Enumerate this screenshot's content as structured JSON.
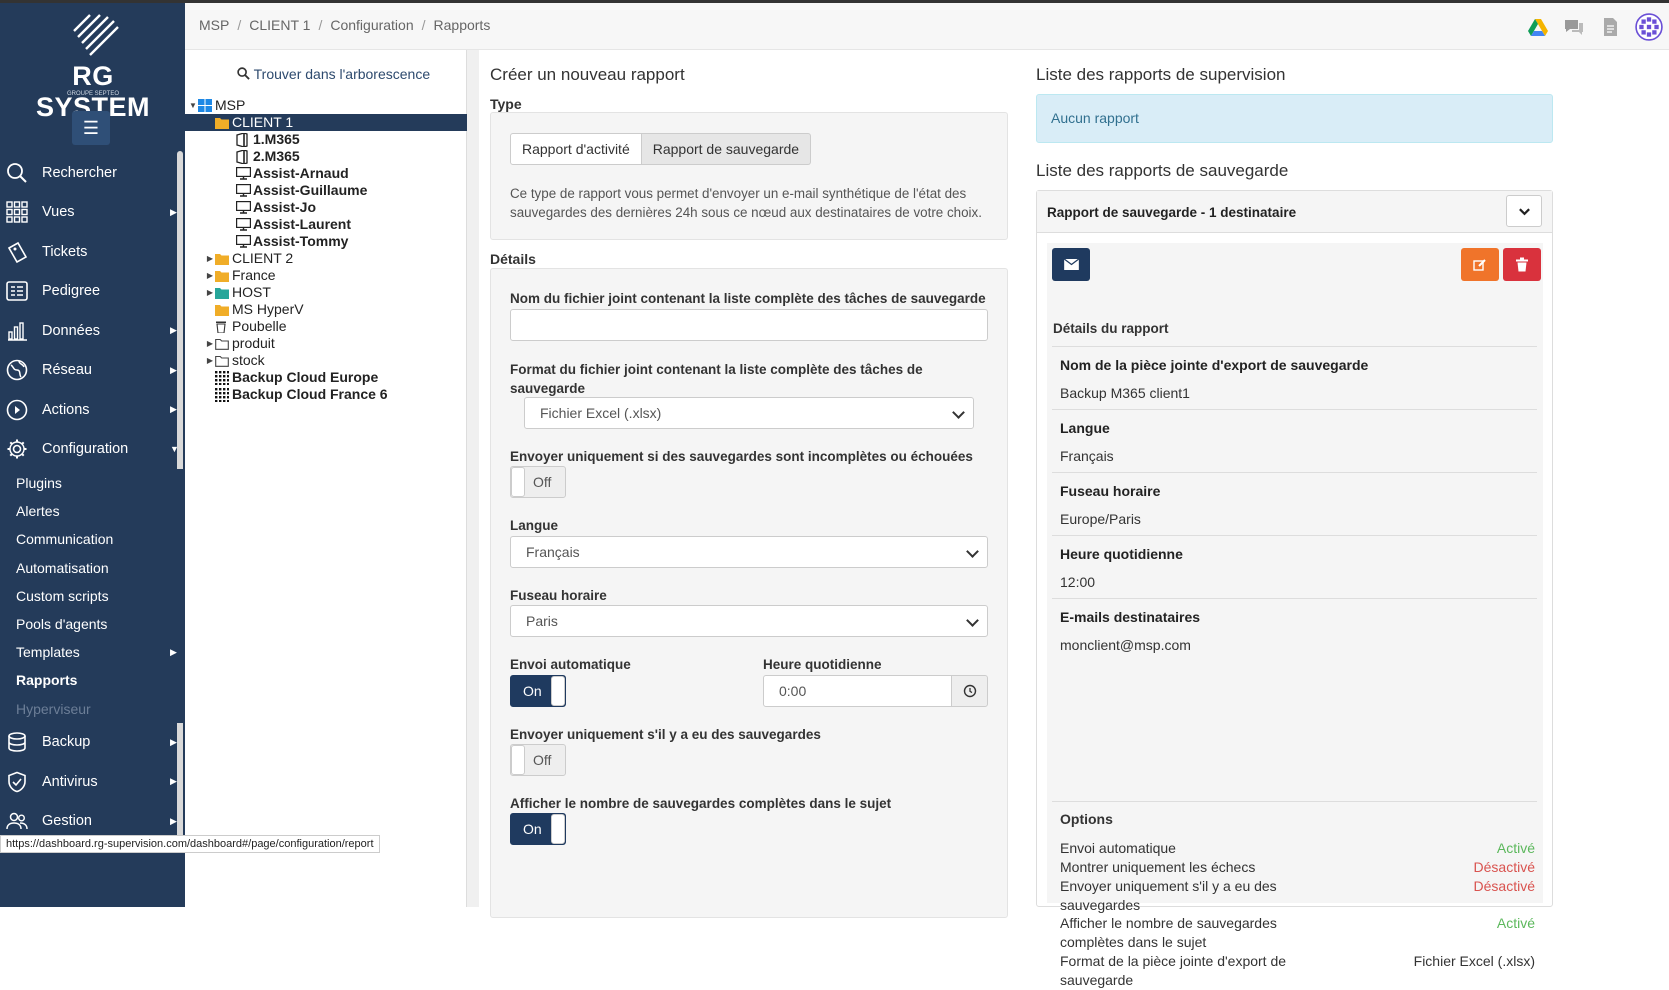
{
  "app": {
    "brand": "RG SYSTEM",
    "brand_sub": "GROUPE SEPTEO",
    "status_url": "https://dashboard.rg-supervision.com/dashboard#/page/configuration/report"
  },
  "colors": {
    "sidebar": "#243b5a",
    "accent": "#1f3a5f",
    "orange": "#f0742a",
    "red": "#d9323d",
    "active_green": "#5cb85c",
    "inactive_red": "#d9534f"
  },
  "breadcrumb": [
    "MSP",
    "CLIENT 1",
    "Configuration",
    "Rapports"
  ],
  "header_icons": [
    "drive-icon",
    "chat-icon",
    "document-icon",
    "avatar-icon"
  ],
  "sidebar": {
    "items": [
      {
        "label": "Rechercher",
        "icon": "search-icon",
        "arrow": false
      },
      {
        "label": "Vues",
        "icon": "grid-icon",
        "arrow": true
      },
      {
        "label": "Tickets",
        "icon": "ticket-icon",
        "arrow": false
      },
      {
        "label": "Pedigree",
        "icon": "list-icon",
        "arrow": false
      },
      {
        "label": "Données",
        "icon": "bar-chart-icon",
        "arrow": true
      },
      {
        "label": "Réseau",
        "icon": "globe-icon",
        "arrow": true
      },
      {
        "label": "Actions",
        "icon": "play-icon",
        "arrow": true
      },
      {
        "label": "Configuration",
        "icon": "gear-icon",
        "arrow": "down"
      }
    ],
    "sub_items": [
      "Plugins",
      "Alertes",
      "Communication",
      "Automatisation",
      "Custom scripts",
      "Pools d'agents",
      "Templates",
      "Rapports",
      "Hyperviseur"
    ],
    "bottom_items": [
      {
        "label": "Backup",
        "icon": "database-icon"
      },
      {
        "label": "Antivirus",
        "icon": "shield-icon"
      },
      {
        "label": "Gestion",
        "icon": "users-icon"
      }
    ]
  },
  "tree": {
    "find_label": "Trouver dans l'arborescence",
    "nodes": [
      {
        "label": "MSP",
        "level": 0,
        "toggle": "▼",
        "icon": "windows-icon",
        "bold": false,
        "selected": false
      },
      {
        "label": "CLIENT 1",
        "level": 1,
        "toggle": "",
        "icon": "folder-icon",
        "bold": false,
        "selected": true
      },
      {
        "label": "1.M365",
        "level": 2,
        "toggle": "",
        "icon": "office-icon",
        "bold": true,
        "selected": false
      },
      {
        "label": "2.M365",
        "level": 2,
        "toggle": "",
        "icon": "office-icon",
        "bold": true,
        "selected": false
      },
      {
        "label": "Assist-Arnaud",
        "level": 2,
        "toggle": "",
        "icon": "monitor-icon",
        "bold": true,
        "selected": false
      },
      {
        "label": "Assist-Guillaume",
        "level": 2,
        "toggle": "",
        "icon": "monitor-icon",
        "bold": true,
        "selected": false
      },
      {
        "label": "Assist-Jo",
        "level": 2,
        "toggle": "",
        "icon": "monitor-icon",
        "bold": true,
        "selected": false
      },
      {
        "label": "Assist-Laurent",
        "level": 2,
        "toggle": "",
        "icon": "monitor-icon",
        "bold": true,
        "selected": false
      },
      {
        "label": "Assist-Tommy",
        "level": 2,
        "toggle": "",
        "icon": "monitor-icon",
        "bold": true,
        "selected": false
      },
      {
        "label": "CLIENT 2",
        "level": 1,
        "toggle": "▶",
        "icon": "folder-icon",
        "bold": false,
        "selected": false
      },
      {
        "label": "France",
        "level": 1,
        "toggle": "▶",
        "icon": "folder-icon",
        "bold": false,
        "selected": false
      },
      {
        "label": "HOST",
        "level": 1,
        "toggle": "▶",
        "icon": "folder-green-icon",
        "bold": false,
        "selected": false
      },
      {
        "label": "MS HyperV",
        "level": 1,
        "toggle": "",
        "icon": "folder-icon",
        "bold": false,
        "selected": false
      },
      {
        "label": "Poubelle",
        "level": 1,
        "toggle": "",
        "icon": "trash-icon",
        "bold": false,
        "selected": false
      },
      {
        "label": "produit",
        "level": 1,
        "toggle": "▶",
        "icon": "folder-outline-icon",
        "bold": false,
        "selected": false
      },
      {
        "label": "stock",
        "level": 1,
        "toggle": "▶",
        "icon": "folder-outline-icon",
        "bold": false,
        "selected": false
      },
      {
        "label": "Backup Cloud Europe",
        "level": 1,
        "toggle": "",
        "icon": "dots-icon",
        "bold": true,
        "selected": false
      },
      {
        "label": "Backup Cloud France 6",
        "level": 1,
        "toggle": "",
        "icon": "dots-icon",
        "bold": true,
        "selected": false
      }
    ]
  },
  "create": {
    "title": "Créer un nouveau rapport",
    "type_label": "Type",
    "type_buttons": [
      "Rapport d'activité",
      "Rapport de sauvegarde"
    ],
    "type_selected": "Rapport de sauvegarde",
    "type_desc_1": "Ce type de rapport vous permet d'envoyer un e-mail synthétique de l'état des",
    "type_desc_2": "sauvegardes des dernières 24h sous ce nœud aux destinataires de votre choix.",
    "details_label": "Détails",
    "f_filename_label": "Nom du fichier joint contenant la liste complète des tâches de sauvegarde",
    "f_filename_value": "",
    "f_format_label_1": "Format du fichier joint contenant la liste complète des tâches de",
    "f_format_label_2": "sauvegarde",
    "f_format_value": "Fichier Excel (.xlsx)",
    "f_incomplete_label": "Envoyer uniquement si des sauvegardes sont incomplètes ou échouées",
    "f_incomplete_value": "Off",
    "f_lang_label": "Langue",
    "f_lang_value": "Français",
    "f_tz_label": "Fuseau horaire",
    "f_tz_value": "Paris",
    "f_auto_label": "Envoi automatique",
    "f_auto_value": "On",
    "f_time_label": "Heure quotidienne",
    "f_time_value": "0:00",
    "f_only_label": "Envoyer uniquement s'il y a eu des sauvegardes",
    "f_only_value": "Off",
    "f_count_label": "Afficher le nombre de sauvegardes complètes dans le sujet",
    "f_count_value": "On"
  },
  "supervision": {
    "title": "Liste des rapports de supervision",
    "empty": "Aucun rapport"
  },
  "backup": {
    "title": "Liste des rapports de sauvegarde",
    "panel_title": "Rapport de sauvegarde - 1 destinataire",
    "details_title": "Détails du rapport",
    "rows": [
      {
        "key": "Nom de la pièce jointe d'export de sauvegarde",
        "value": "Backup M365 client1"
      },
      {
        "key": "Langue",
        "value": "Français"
      },
      {
        "key": "Fuseau horaire",
        "value": "Europe/Paris"
      },
      {
        "key": "Heure quotidienne",
        "value": "12:00"
      },
      {
        "key": "E-mails destinataires",
        "value": "monclient@msp.com"
      }
    ],
    "options_title": "Options",
    "options": [
      {
        "label_1": "Envoi automatique",
        "label_2": "",
        "value": "Activé",
        "state": "on"
      },
      {
        "label_1": "Montrer uniquement les échecs",
        "label_2": "",
        "value": "Désactivé",
        "state": "off"
      },
      {
        "label_1": "Envoyer uniquement s'il y a eu des",
        "label_2": "sauvegardes",
        "value": "Désactivé",
        "state": "off"
      },
      {
        "label_1": "Afficher le nombre de sauvegardes",
        "label_2": "complètes dans le sujet",
        "value": "Activé",
        "state": "on"
      },
      {
        "label_1": "Format de la pièce jointe d'export de",
        "label_2": "sauvegarde",
        "value": "Fichier Excel (.xlsx)",
        "state": "neutral"
      }
    ]
  }
}
